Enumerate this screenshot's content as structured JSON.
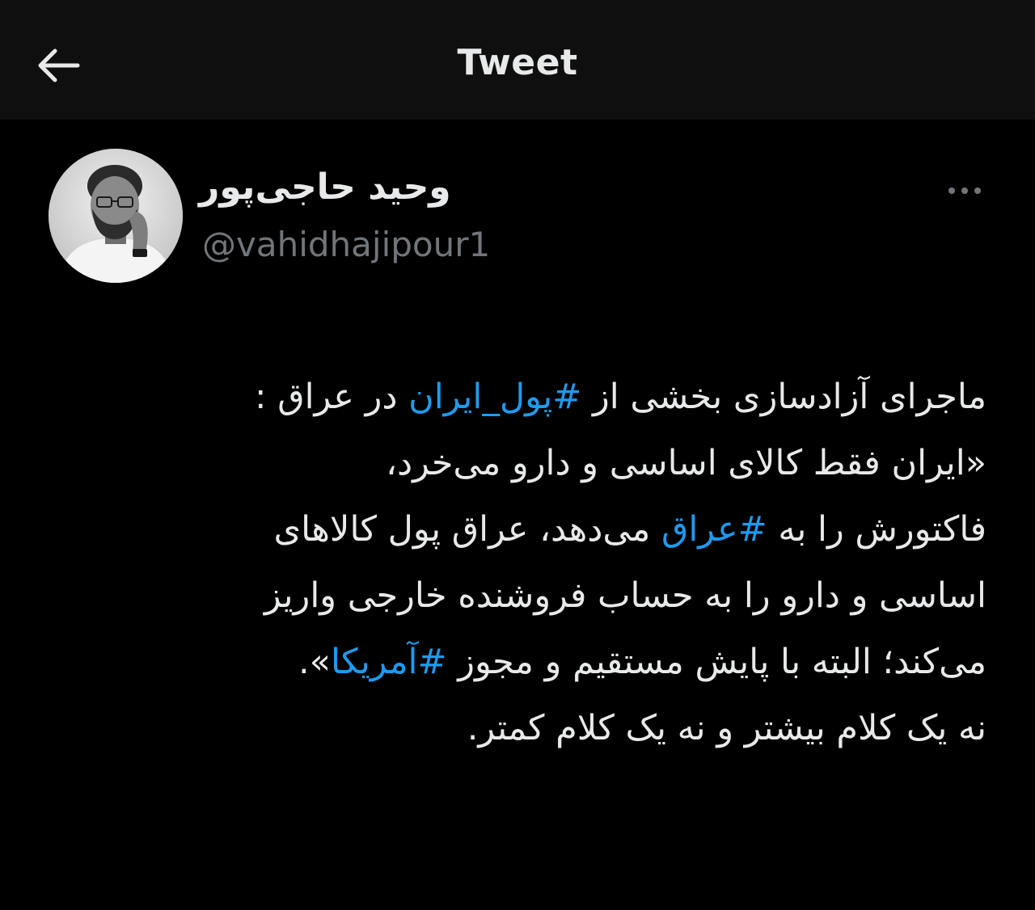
{
  "header": {
    "title": "Tweet",
    "back_icon": "arrow-left-icon"
  },
  "author": {
    "display_name": "وحید حاجی‌پور",
    "handle": "@vahidhajipour1",
    "avatar": "avatar-photo-grayscale"
  },
  "menu_icon": "more-horizontal-icon",
  "tweet": {
    "lines": [
      [
        {
          "text": "ماجرای آزادسازی بخشی از ",
          "type": "text"
        },
        {
          "text": "#پول_ایران",
          "type": "hashtag"
        },
        {
          "text": " در عراق :",
          "type": "text"
        }
      ],
      [
        {
          "text": "«ایران فقط کالای اساسی و دارو می‌خرد،",
          "type": "text"
        }
      ],
      [
        {
          "text": "فاکتورش را به ",
          "type": "text"
        },
        {
          "text": "#عراق",
          "type": "hashtag"
        },
        {
          "text": " می‌دهد، عراق پول کالاهای",
          "type": "text"
        }
      ],
      [
        {
          "text": "اساسی و دارو را به حساب فروشنده خارجی واریز",
          "type": "text"
        }
      ],
      [
        {
          "text": "می‌کند؛ البته با پایش مستقیم و مجوز ",
          "type": "text"
        },
        {
          "text": "#آمریکا",
          "type": "hashtag"
        },
        {
          "text": "».",
          "type": "text"
        }
      ],
      [
        {
          "text": "نه یک کلام بیشتر و نه یک کلام کمتر.",
          "type": "text"
        }
      ]
    ]
  },
  "colors": {
    "background": "#000000",
    "header_background": "#0f0f0f",
    "text": "#e7e9ea",
    "secondary_text": "#71767b",
    "link": "#1d9bf0"
  }
}
